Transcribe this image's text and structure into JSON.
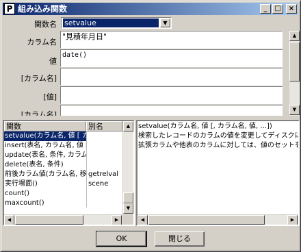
{
  "window": {
    "title": "組み込み関数",
    "app_icon": "P"
  },
  "titlebar_buttons": {
    "minimize": "_",
    "maximize": "□",
    "close": "×"
  },
  "form": {
    "function_name_label": "関数名",
    "function_name_value": "setvalue",
    "fields": [
      {
        "label": "カラム名",
        "value": "\"見積年月日\""
      },
      {
        "label": "値",
        "value": "date()"
      },
      {
        "label": "[カラム名]",
        "value": ""
      },
      {
        "label": "[値]",
        "value": ""
      },
      {
        "label": "[カラム名]",
        "value": ""
      }
    ]
  },
  "function_list": {
    "headers": {
      "function": "関数",
      "alias": "別名"
    },
    "rows": [
      {
        "function": "setvalue(カラム名, 値 [ カラ",
        "alias": ""
      },
      {
        "function": "insert(表名, カラム名, 値 [",
        "alias": ""
      },
      {
        "function": "update(表名, 条件, カラム名",
        "alias": ""
      },
      {
        "function": "delete(表名, 条件)",
        "alias": ""
      },
      {
        "function": "前後カラム値(カラム名, 移",
        "alias": "getrelval"
      },
      {
        "function": "実行場面()",
        "alias": "scene"
      },
      {
        "function": "count()",
        "alias": ""
      },
      {
        "function": "maxcount()",
        "alias": ""
      }
    ]
  },
  "description": {
    "lines": [
      "setvalue(カラム名, 値 [, カラム名, 値, ...])",
      "検索したレコードのカラムの値を変更してディスクに書",
      "拡張カラムや他表のカラムに対しては、値のセットを行"
    ]
  },
  "buttons": {
    "ok": "OK",
    "close": "閉じる"
  },
  "icons": {
    "dropdown": "▼",
    "up": "▲",
    "down": "▼",
    "left": "◀",
    "right": "▶"
  },
  "colors": {
    "title_start": "#0a246a",
    "title_end": "#a6caf0",
    "selection": "#0a246a",
    "face": "#d4d0c8"
  }
}
